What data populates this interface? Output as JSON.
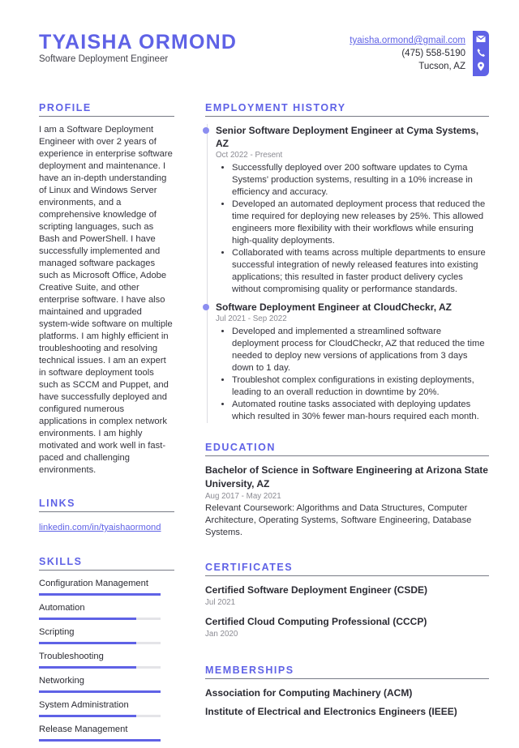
{
  "header": {
    "name": "TYAISHA ORMOND",
    "title": "Software Deployment Engineer",
    "email": "tyaisha.ormond@gmail.com",
    "phone": "(475) 558-5190",
    "location": "Tucson, AZ",
    "icons": [
      "envelope-icon",
      "phone-icon",
      "map-pin-icon"
    ]
  },
  "colors": {
    "accent": "#5f62e6",
    "text": "#2b2b33",
    "muted": "#8a8a92"
  },
  "profile": {
    "heading": "PROFILE",
    "text": "I am a Software Deployment Engineer with over 2 years of experience in enterprise software deployment and maintenance. I have an in-depth understanding of Linux and Windows Server environments, and a comprehensive knowledge of scripting languages, such as Bash and PowerShell. I have successfully implemented and managed software packages such as Microsoft Office, Adobe Creative Suite, and other enterprise software. I have also maintained and upgraded system-wide software on multiple platforms. I am highly efficient in troubleshooting and resolving technical issues. I am an expert in software deployment tools such as SCCM and Puppet, and have successfully deployed and configured numerous applications in complex network environments. I am highly motivated and work well in fast-paced and challenging environments."
  },
  "links": {
    "heading": "LINKS",
    "items": [
      {
        "label": "linkedin.com/in/tyaishaormond"
      }
    ]
  },
  "skills": {
    "heading": "SKILLS",
    "items": [
      {
        "label": "Configuration Management",
        "level": 100
      },
      {
        "label": "Automation",
        "level": 80
      },
      {
        "label": "Scripting",
        "level": 80
      },
      {
        "label": "Troubleshooting",
        "level": 80
      },
      {
        "label": "Networking",
        "level": 100
      },
      {
        "label": "System Administration",
        "level": 80
      },
      {
        "label": "Release Management",
        "level": 100
      }
    ]
  },
  "employment": {
    "heading": "EMPLOYMENT HISTORY",
    "jobs": [
      {
        "title": "Senior Software Deployment Engineer at Cyma Systems, AZ",
        "dates": "Oct 2022 - Present",
        "bullets": [
          "Successfully deployed over 200 software updates to Cyma Systems' production systems, resulting in a 10% increase in efficiency and accuracy.",
          "Developed an automated deployment process that reduced the time required for deploying new releases by 25%. This allowed engineers more flexibility with their workflows while ensuring high-quality deployments.",
          "Collaborated with teams across multiple departments to ensure successful integration of newly released features into existing applications; this resulted in faster product delivery cycles without compromising quality or performance standards."
        ]
      },
      {
        "title": "Software Deployment Engineer at CloudCheckr, AZ",
        "dates": "Jul 2021 - Sep 2022",
        "bullets": [
          "Developed and implemented a streamlined software deployment process for CloudCheckr, AZ that reduced the time needed to deploy new versions of applications from 3 days down to 1 day.",
          "Troubleshot complex configurations in existing deployments, leading to an overall reduction in downtime by 20%.",
          "Automated routine tasks associated with deploying updates which resulted in 30% fewer man-hours required each month."
        ]
      }
    ]
  },
  "education": {
    "heading": "EDUCATION",
    "items": [
      {
        "title": "Bachelor of Science in Software Engineering at Arizona State University, AZ",
        "dates": "Aug 2017 - May 2021",
        "description": "Relevant Coursework: Algorithms and Data Structures, Computer Architecture, Operating Systems, Software Engineering, Database Systems."
      }
    ]
  },
  "certificates": {
    "heading": "CERTIFICATES",
    "items": [
      {
        "title": "Certified Software Deployment Engineer (CSDE)",
        "date": "Jul 2021"
      },
      {
        "title": "Certified Cloud Computing Professional (CCCP)",
        "date": "Jan 2020"
      }
    ]
  },
  "memberships": {
    "heading": "MEMBERSHIPS",
    "items": [
      {
        "title": "Association for Computing Machinery (ACM)"
      },
      {
        "title": "Institute of Electrical and Electronics Engineers (IEEE)"
      }
    ]
  }
}
